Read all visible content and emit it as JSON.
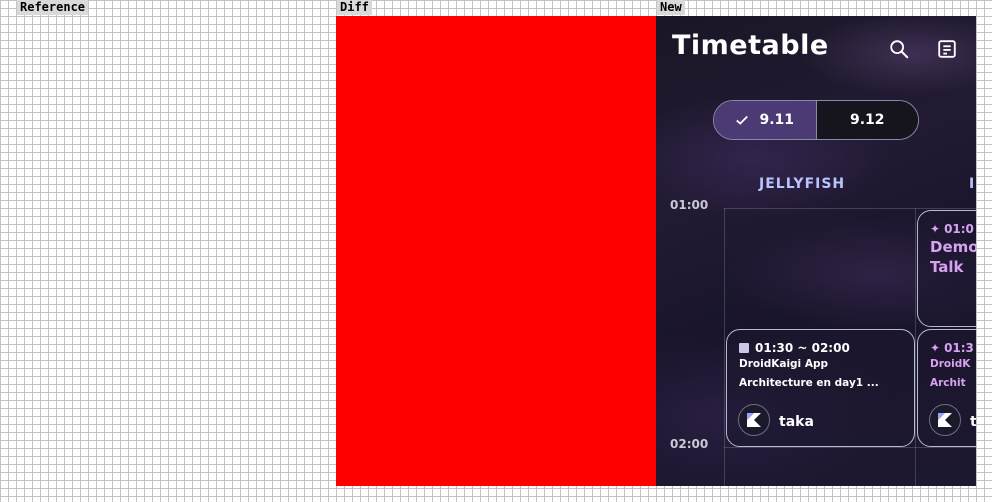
{
  "panels": {
    "reference_label": "Reference",
    "diff_label": "Diff",
    "new_label": "New"
  },
  "app": {
    "title": "Timetable",
    "icons": [
      "search-icon",
      "bookmark-list-icon"
    ]
  },
  "day_tabs": [
    {
      "label": "9.11",
      "selected": true
    },
    {
      "label": "9.12",
      "selected": false
    }
  ],
  "rooms": [
    "JELLYFISH",
    "I"
  ],
  "time_slots": [
    "01:00",
    "02:00"
  ],
  "sessions": [
    {
      "time": "01:30 ~ 02:00",
      "title_line1": "DroidKaigi App",
      "title_line2": "Architecture en day1 ...",
      "speaker": "taka"
    },
    {
      "time": "01:0",
      "title_line1": "Demo",
      "title_line2": "Talk"
    },
    {
      "time": "01:3",
      "title_line1": "DroidK",
      "title_line2": "Archit",
      "speaker": "t"
    }
  ],
  "colors": {
    "diff_fill": "#ff0000",
    "selected_day": "#4b3a74",
    "room_header": "#b9c4ff",
    "accent_pink": "#d7a3f0"
  }
}
